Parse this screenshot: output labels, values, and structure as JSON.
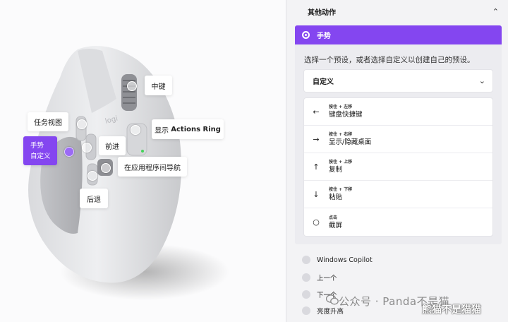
{
  "callouts": {
    "middle": "中键",
    "task_view": "任务视图",
    "show_actions_ring_prefix": "显示",
    "show_actions_ring_bold": "Actions Ring",
    "gesture_title": "手势",
    "gesture_sub": "自定义",
    "forward": "前进",
    "app_nav": "在应用程序间导航",
    "back": "后退"
  },
  "panel": {
    "section_title": "其他动作",
    "gesture": {
      "label": "手势",
      "instruction": "选择一个预设，或者选择自定义以创建自己的预设。",
      "preset_value": "自定义",
      "rows": [
        {
          "icon": "arrow-left-icon",
          "glyph": "←",
          "sub": "按住 + 左移",
          "main": "键盘快捷键"
        },
        {
          "icon": "arrow-right-icon",
          "glyph": "→",
          "sub": "按住 + 右移",
          "main": "显示/隐藏桌面"
        },
        {
          "icon": "arrow-up-icon",
          "glyph": "↑",
          "sub": "按住 + 上移",
          "main": "复制"
        },
        {
          "icon": "arrow-down-icon",
          "glyph": "↓",
          "sub": "按住 + 下移",
          "main": "粘贴"
        },
        {
          "icon": "click-circle-icon",
          "glyph": "○",
          "sub": "点击",
          "main": "截屏"
        }
      ]
    },
    "options": [
      "Windows Copilot",
      "上一个",
      "下一个",
      "亮度升高"
    ]
  },
  "watermark": {
    "text": "公众号 · Panda不是猫",
    "overlay": "熊猫不是猫猫"
  },
  "colors": {
    "accent": "#8446f0"
  }
}
